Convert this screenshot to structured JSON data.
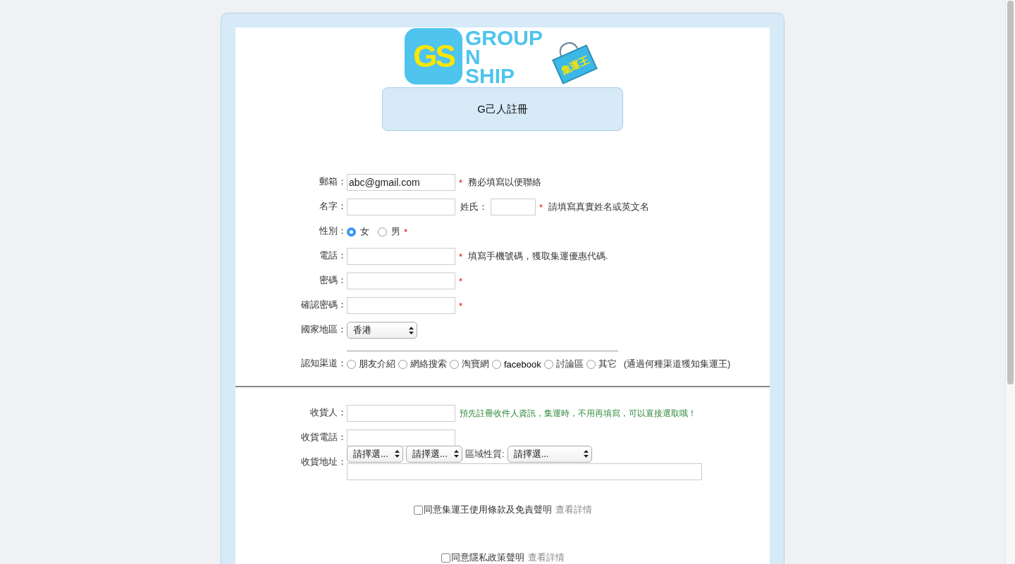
{
  "logo": {
    "badge": "GS",
    "lines": [
      "GROUP",
      "N",
      "SHIP"
    ],
    "bag": "集運王"
  },
  "title": "G己人註冊",
  "personal": [
    {
      "kind": "text",
      "label": "郵箱：",
      "value": "abc@gmail.com",
      "mark": "*",
      "note": "務必填寫以便聯絡"
    },
    {
      "kind": "name",
      "label": "名字：",
      "second_label": "姓氏：",
      "mark": "*",
      "note": "請填寫真實姓名或英文名"
    },
    {
      "kind": "radio",
      "label": "性別：",
      "options": [
        {
          "label": "女",
          "selected": true
        },
        {
          "label": "男",
          "selected": false
        }
      ],
      "mark": "*"
    },
    {
      "kind": "text",
      "label": "電話：",
      "mark": "*",
      "note": "填寫手機號碼，獲取集運優惠代碼."
    },
    {
      "kind": "text",
      "label": "密碼：",
      "mark": "*"
    },
    {
      "kind": "text",
      "label": "確認密碼：",
      "mark": "*"
    },
    {
      "kind": "select",
      "label": "國家地區：",
      "value": "香港"
    },
    {
      "kind": "channels",
      "label": "認知渠道：",
      "options": [
        {
          "label": "朋友介紹",
          "selected": false
        },
        {
          "label": "網絡搜索",
          "selected": false
        },
        {
          "label": "淘寶網",
          "selected": false
        },
        {
          "label": "facebook",
          "selected": false
        },
        {
          "label": "討論區",
          "selected": false
        },
        {
          "label": "其它",
          "selected": false
        }
      ],
      "note": "(通過何種渠道獲知集運王)"
    }
  ],
  "receiver": [
    {
      "kind": "text",
      "label": "收貨人：",
      "hint": "預先註冊收件人資訊，集運時，不用再填寫，可以直接選取哦！"
    },
    {
      "kind": "text",
      "label": "收貨電話："
    },
    {
      "kind": "address",
      "label": "收貨地址：",
      "selects": [
        "請擇選...",
        "請擇選..."
      ],
      "area_label": "區域性質:",
      "area_select": "請擇選..."
    }
  ],
  "agreements": [
    {
      "text": "同意集運王使用條款及免責聲明",
      "link": "查看詳情",
      "checked": false
    },
    {
      "text": "同意隱私政策聲明",
      "link": "查看詳情",
      "checked": false
    }
  ]
}
